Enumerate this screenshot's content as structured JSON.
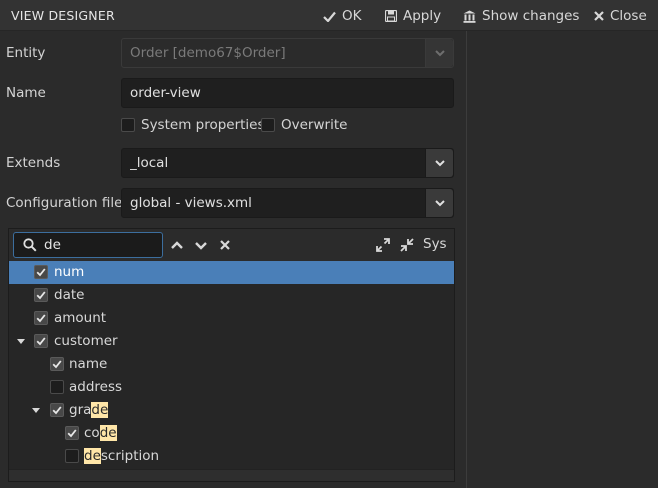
{
  "window": {
    "title": "VIEW DESIGNER",
    "buttons": {
      "ok": "OK",
      "apply": "Apply",
      "show_changes": "Show changes",
      "close": "Close"
    }
  },
  "form": {
    "entity": {
      "label": "Entity",
      "value": "Order [demo67$Order]",
      "disabled": true
    },
    "name": {
      "label": "Name",
      "value": "order-view"
    },
    "system_properties": {
      "label": "System properties",
      "checked": false
    },
    "overwrite": {
      "label": "Overwrite",
      "checked": false
    },
    "extends": {
      "label": "Extends",
      "value": "_local"
    },
    "config_file": {
      "label": "Configuration file",
      "value": "global - views.xml"
    }
  },
  "tree": {
    "search": {
      "value": "de",
      "placeholder": ""
    },
    "sys_label": "Sys",
    "rows": [
      {
        "label": "num",
        "checked": true,
        "selected": true,
        "pre": "num",
        "hl": "",
        "post": ""
      },
      {
        "label": "date",
        "checked": true,
        "pre": "date",
        "hl": "",
        "post": ""
      },
      {
        "label": "amount",
        "checked": true,
        "pre": "amount",
        "hl": "",
        "post": ""
      },
      {
        "label": "customer",
        "checked": true,
        "expanded": true,
        "pre": "customer",
        "hl": "",
        "post": ""
      },
      {
        "label": "name",
        "checked": true,
        "pre": "name",
        "hl": "",
        "post": ""
      },
      {
        "label": "address",
        "checked": false,
        "pre": "address",
        "hl": "",
        "post": ""
      },
      {
        "label": "grade",
        "checked": true,
        "expanded": true,
        "pre": "gra",
        "hl": "de",
        "post": ""
      },
      {
        "label": "code",
        "checked": true,
        "pre": "co",
        "hl": "de",
        "post": ""
      },
      {
        "label": "description",
        "checked": false,
        "pre": "",
        "hl": "de",
        "post": "scription"
      }
    ]
  },
  "colors": {
    "background": "#2b2b2b",
    "selection": "#4a7fb8",
    "highlight": "#ffe6a8",
    "field_bg": "#1f1f1f"
  }
}
